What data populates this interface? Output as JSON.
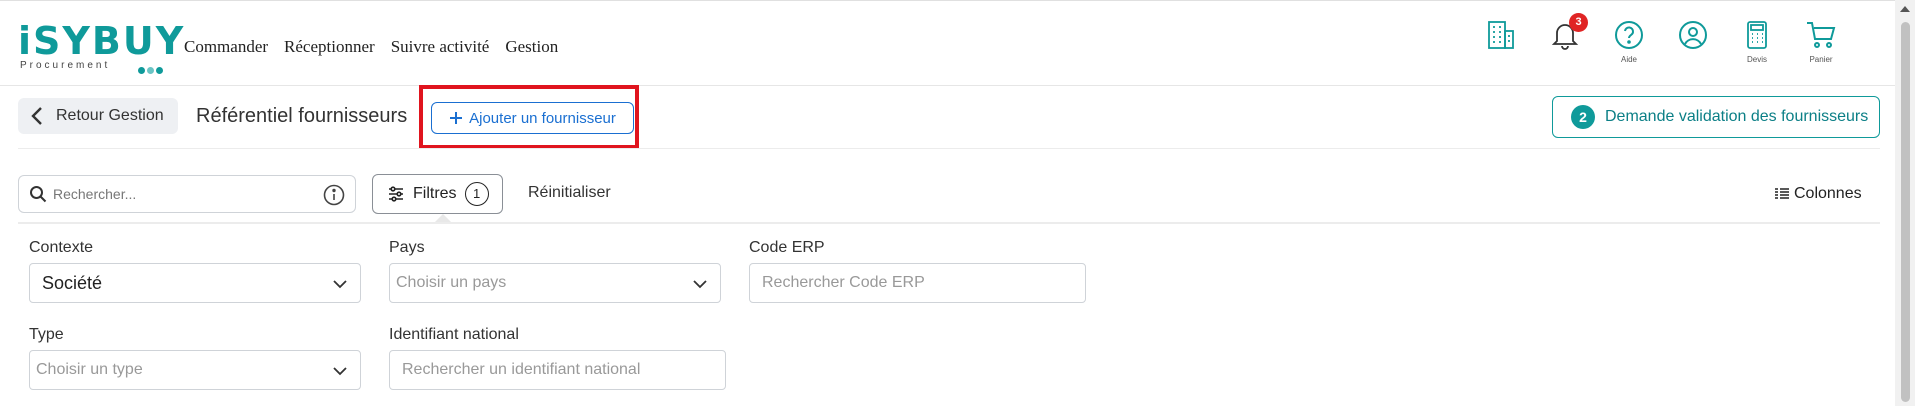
{
  "app": {
    "logo_text": "iSYBUY",
    "logo_sub": "Procurement",
    "accent": "#0f9a9a",
    "logo_dot_colors": [
      "#0f9a9a",
      "#6ac4c4",
      "#0f9a9a"
    ]
  },
  "nav": {
    "items": [
      {
        "label": "Commander"
      },
      {
        "label": "Réceptionner"
      },
      {
        "label": "Suivre activité"
      },
      {
        "label": "Gestion"
      }
    ]
  },
  "top_icons": [
    {
      "name": "building-icon",
      "label": ""
    },
    {
      "name": "bell-icon",
      "label": "",
      "badge": "3"
    },
    {
      "name": "help-icon",
      "label": "Aide"
    },
    {
      "name": "user-icon",
      "label": ""
    },
    {
      "name": "calculator-icon",
      "label": "Devis"
    },
    {
      "name": "cart-icon",
      "label": "Panier"
    }
  ],
  "toolbar": {
    "back_label": "Retour Gestion",
    "title": "Référentiel fournisseurs",
    "add_label": "Ajouter un fournisseur",
    "highlight_color": "#e0141e",
    "validate_count": "2",
    "validate_label": "Demande validation des fournisseurs"
  },
  "search": {
    "placeholder": "Rechercher...",
    "filters_label": "Filtres",
    "filters_count": "1",
    "reset_label": "Réinitialiser",
    "columns_label": "Colonnes"
  },
  "filters": {
    "contexte": {
      "label": "Contexte",
      "value": "Société"
    },
    "pays": {
      "label": "Pays",
      "placeholder": "Choisir un pays"
    },
    "code_erp": {
      "label": "Code ERP",
      "placeholder": "Rechercher Code ERP"
    },
    "type": {
      "label": "Type",
      "placeholder": "Choisir un type"
    },
    "identifiant": {
      "label": "Identifiant national",
      "placeholder": "Rechercher un identifiant national"
    }
  }
}
